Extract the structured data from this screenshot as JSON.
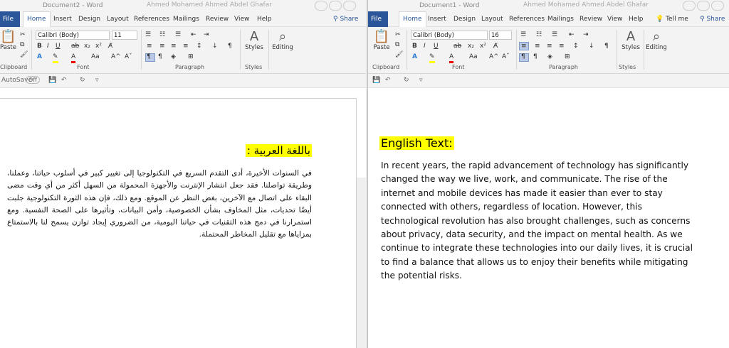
{
  "left_window": {
    "title": "Document2 - Word",
    "user": "Ahmed Mohamed Ahmed Abdel Ghafar",
    "tabs": [
      "File",
      "Home",
      "Insert",
      "Design",
      "Layout",
      "References",
      "Mailings",
      "Review",
      "View",
      "Help"
    ],
    "share": "Share",
    "ribbon": {
      "font_name": "Calibri (Body)",
      "font_size": "11",
      "paste": "Paste",
      "styles": "Styles",
      "editing": "Editing",
      "groups": [
        "Clipboard",
        "Font",
        "Paragraph",
        "Styles"
      ]
    },
    "autosave": "AutoSave",
    "autosave_state": "Off",
    "heading": "باللغة العربية :",
    "body": "في السنوات الأخيرة، أدى التقدم السريع في التكنولوجيا إلى تغيير كبير في أسلوب حياتنا، وعملنا، وطريقة تواصلنا. فقد جعل انتشار الإنترنت والأجهزة المحمولة من السهل أكثر من أي وقت مضى البقاء على اتصال مع الآخرين، بغض النظر عن الموقع. ومع ذلك، فإن هذه الثورة التكنولوجية جلبت أيضًا تحديات، مثل المخاوف بشأن الخصوصية، وأمن البيانات، وتأثيرها على الصحة النفسية. ومع استمرارنا في دمج هذه التقنيات في حياتنا اليومية، من الضروري إيجاد توازن يسمح لنا بالاستمتاع بمزاياها مع تقليل المخاطر المحتملة."
  },
  "right_window": {
    "title": "Document1 - Word",
    "user": "Ahmed Mohamed Ahmed Abdel Ghafar",
    "tabs": [
      "File",
      "Home",
      "Insert",
      "Design",
      "Layout",
      "References",
      "Mailings",
      "Review",
      "View",
      "Help"
    ],
    "tell_me": "Tell me",
    "share": "Share",
    "ribbon": {
      "font_name": "Calibri (Body)",
      "font_size": "16",
      "paste": "Paste",
      "styles": "Styles",
      "editing": "Editing",
      "groups": [
        "Clipboard",
        "Font",
        "Paragraph",
        "Styles"
      ]
    },
    "heading": "English Text:",
    "body": "In recent years, the rapid advancement of technology has significantly changed the way we live, work, and communicate. The rise of the internet and mobile devices has made it easier than ever to stay connected with others, regardless of location. However, this technological revolution has also brought challenges, such as concerns about privacy, data security, and the impact on mental health. As we continue to integrate these technologies into our daily lives, it is crucial to find a balance that allows us to enjoy their benefits while mitigating the potential risks."
  },
  "colors": {
    "word_blue": "#2b579a",
    "highlight": "#ffff00",
    "ribbon_bg": "#f3f3f3"
  },
  "icons": [
    "paste-icon",
    "cut-icon",
    "copy-icon",
    "format-painter-icon",
    "bold-icon",
    "italic-icon",
    "underline-icon",
    "strikethrough-icon",
    "subscript-icon",
    "superscript-icon",
    "text-effects-icon",
    "highlight-icon",
    "font-color-icon",
    "change-case-icon",
    "grow-font-icon",
    "shrink-font-icon",
    "bullets-icon",
    "numbering-icon",
    "multilevel-icon",
    "align-left-icon",
    "center-icon",
    "align-right-icon",
    "justify-icon",
    "line-spacing-icon",
    "shading-icon",
    "borders-icon",
    "sort-icon",
    "pilcrow-icon",
    "rtl-icon",
    "ltr-icon",
    "styles-icon",
    "search-icon",
    "save-icon",
    "undo-icon",
    "redo-icon",
    "lightbulb-icon",
    "person-icon"
  ]
}
